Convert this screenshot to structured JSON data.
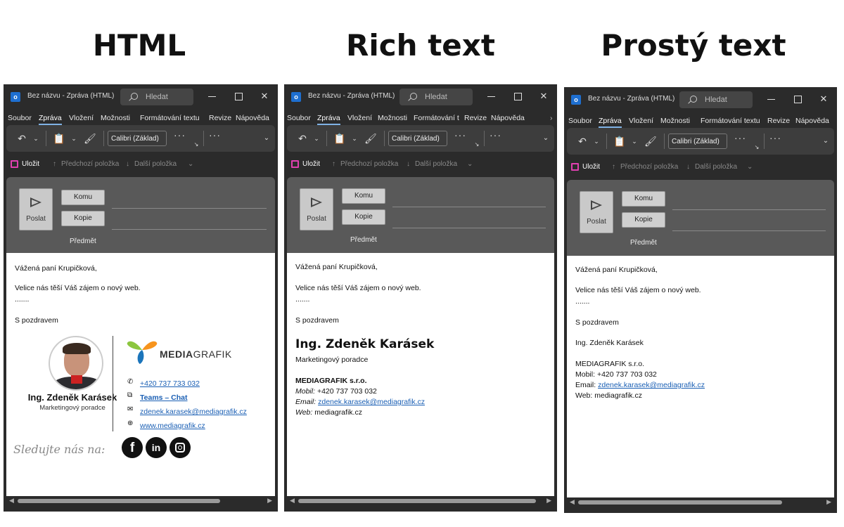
{
  "headings": [
    "HTML",
    "Rich text",
    "Prostý text"
  ],
  "app": {
    "search_placeholder": "Hledat",
    "menu": [
      "Soubor",
      "Zpráva",
      "Vložení",
      "Možnosti",
      "Formátování textu",
      "Revize",
      "Nápověda"
    ],
    "menu_rich": [
      "Soubor",
      "Zpráva",
      "Vložení",
      "Možnosti",
      "Formátování t",
      "Revize",
      "Nápověda"
    ],
    "font": "Calibri (Základ)",
    "quick": {
      "save": "Uložit",
      "prev": "Předchozí položka",
      "next": "Další položka"
    },
    "compose": {
      "send": "Poslat",
      "to": "Komu",
      "cc": "Kopie",
      "subject": "Předmět"
    }
  },
  "windows": [
    {
      "title": "Bez názvu  -  Zpráva (HTML)"
    },
    {
      "title": "Bez názvu  -  Zpráva (HTML)"
    },
    {
      "title": "Bez názvu  -  Zpráva (HTML)"
    }
  ],
  "email": {
    "greeting": "Vážená paní Krupičková,",
    "line1": "Velice nás těší Váš zájem o nový web.",
    "ellipsis": ".......",
    "closing": "S pozdravem"
  },
  "signature": {
    "name": "Ing. Zdeněk Karásek",
    "role": "Marketingový poradce",
    "company": "MEDIAGRAFIK s.r.o.",
    "logo_text_bold": "MEDIA",
    "logo_text_light": "GRAFIK",
    "phone_html": "+420 737 733 032",
    "teams": "Teams – Chat",
    "email": "zdenek.karasek@mediagrafik.cz",
    "web_html": "www.mediagrafik.cz",
    "follow": "Sledujte nás na:",
    "mobile_label": "Mobil:",
    "mobile": "+420 737 703 032",
    "email_label": "Email:",
    "web_label": "Web:",
    "web": "mediagrafik.cz"
  },
  "colors": {
    "window_bg": "#2b2b2b",
    "ribbon_bg": "#3d3d3d",
    "compose_bg": "#595959",
    "link": "#1a5fb4",
    "save_icon": "#e040b0"
  }
}
